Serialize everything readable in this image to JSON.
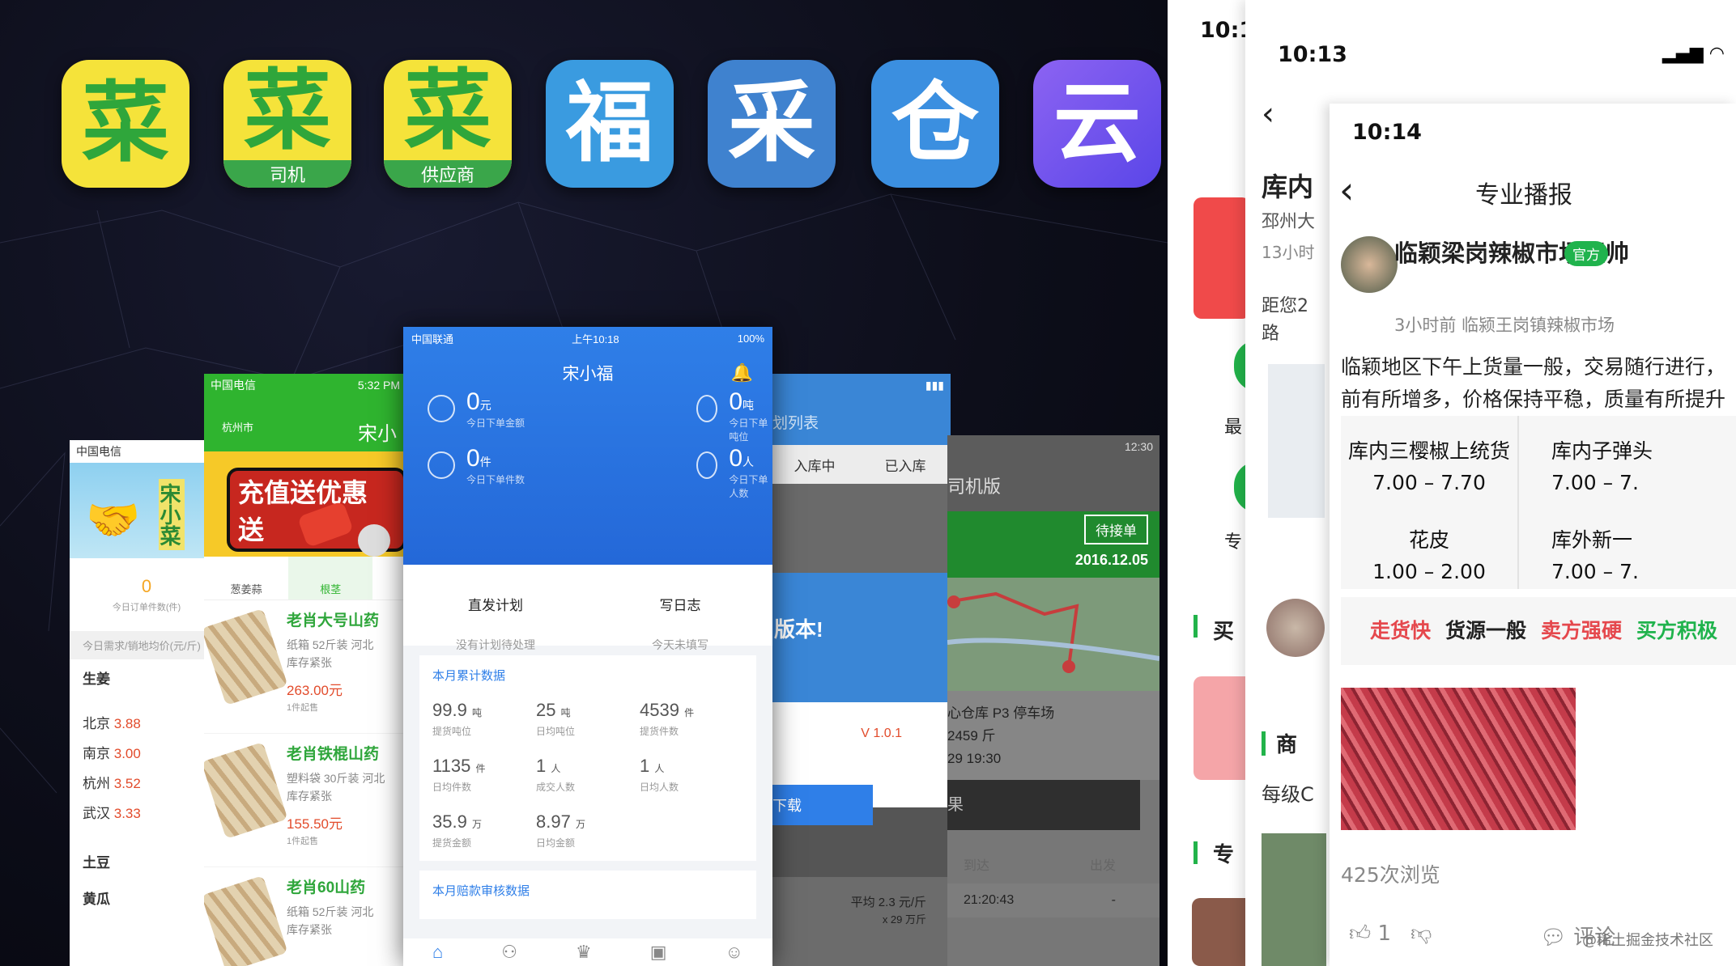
{
  "icons": [
    {
      "glyph": "菜",
      "band": "",
      "style": "yellow"
    },
    {
      "glyph": "菜",
      "band": "司机",
      "style": "yellow"
    },
    {
      "glyph": "菜",
      "band": "供应商",
      "style": "yellow"
    },
    {
      "glyph": "福",
      "band": "",
      "style": "blue1"
    },
    {
      "glyph": "采",
      "band": "",
      "style": "blue2"
    },
    {
      "glyph": "仓",
      "band": "",
      "style": "blue3"
    },
    {
      "glyph": "云",
      "band": "",
      "style": "purple"
    }
  ],
  "phone1": {
    "carrier": "中国电信",
    "logo_text": "宋小菜",
    "zero": "0",
    "zero_label": "今日订单件数(件)",
    "bar_text": "今日需求/销地均价(元/斤)",
    "category": "生姜",
    "prices": [
      {
        "city": "北京",
        "price": "3.88"
      },
      {
        "city": "南京",
        "price": "3.00"
      },
      {
        "city": "杭州",
        "price": "3.52"
      },
      {
        "city": "武汉",
        "price": "3.33"
      }
    ],
    "more": [
      "土豆",
      "黄瓜"
    ]
  },
  "phone2": {
    "carrier": "中国电信",
    "time": "5:32 PM",
    "location": "杭州市",
    "title": "宋小菜",
    "banner": "充值送优惠 送",
    "categories": [
      "葱姜蒜",
      "根茎"
    ],
    "items": [
      {
        "name": "老肖大号山药",
        "desc": "纸箱 52斤装 河北",
        "stock": "库存紧张",
        "price": "263.00元",
        "min": "1件起售"
      },
      {
        "name": "老肖铁棍山药",
        "desc": "塑料袋 30斤装 河北",
        "stock": "库存紧张",
        "price": "155.50元",
        "min": "1件起售"
      },
      {
        "name": "老肖60山药",
        "desc": "纸箱 52斤装 河北",
        "stock": "库存紧张",
        "price": "",
        "min": ""
      }
    ]
  },
  "phone3": {
    "carrier": "中国联通",
    "time": "上午10:18",
    "battery": "100%",
    "title": "宋小福",
    "stats": [
      {
        "value": "0",
        "unit": "元",
        "label": "今日下单金额"
      },
      {
        "value": "0",
        "unit": "吨",
        "label": "今日下单吨位"
      },
      {
        "value": "0",
        "unit": "件",
        "label": "今日下单件数"
      },
      {
        "value": "0",
        "unit": "人",
        "label": "今日下单人数"
      }
    ],
    "actions": [
      {
        "title": "直发计划",
        "sub": "没有计划待处理"
      },
      {
        "title": "写日志",
        "sub": "今天未填写"
      }
    ],
    "card_title": "本月累计数据",
    "grid": [
      {
        "v": "99.9",
        "u": "吨",
        "l": "提货吨位"
      },
      {
        "v": "25",
        "u": "吨",
        "l": "日均吨位"
      },
      {
        "v": "4539",
        "u": "件",
        "l": "提货件数"
      },
      {
        "v": "1135",
        "u": "件",
        "l": "日均件数"
      },
      {
        "v": "1",
        "u": "人",
        "l": "成交人数"
      },
      {
        "v": "1",
        "u": "人",
        "l": "日均人数"
      },
      {
        "v": "35.9",
        "u": "万",
        "l": "提货金额"
      },
      {
        "v": "8.97",
        "u": "万",
        "l": "日均金额"
      }
    ],
    "card2_title": "本月赔款审核数据"
  },
  "phone4": {
    "title": "划列表",
    "tabs": [
      "入库中",
      "已入库"
    ],
    "new_version": "版本!",
    "version": "V 1.0.1",
    "download": "下载",
    "avg": "平均 2.3 元/斤",
    "qty": "x 29 万斤"
  },
  "phone5": {
    "time": "12:30",
    "title": "司机版",
    "pending": "待接单",
    "date": "2016.12.05",
    "info": [
      "心仓库 P3 停车场",
      "2459 斤",
      "29 19:30"
    ],
    "btn": "果",
    "cols": [
      "到达",
      "出发"
    ],
    "row": [
      "21:20:43",
      "-"
    ]
  },
  "right": {
    "time_a": "10:1",
    "time_b": "10:13",
    "time_c": "10:14",
    "a_labels": [
      "最",
      "专",
      "买",
      "专"
    ],
    "b_title": "库内",
    "b_lines": [
      "邳州大",
      "13小时",
      "距您2",
      "路"
    ],
    "b_sections": [
      "商",
      "每级C"
    ],
    "c_title": "专业播报",
    "author": "临颖梁岗辣椒市场王帅",
    "official": "官方",
    "meta": "3小时前  临颍王岗镇辣椒市场",
    "body": "临颖地区下午上货量一般，交易随行进行，前有所增多，价格保持平稳，质量有所提升",
    "prices": [
      {
        "name": "库内三樱椒上统货",
        "range": "7.00 – 7.70"
      },
      {
        "name": "库内子弹头",
        "range": "7.00 – 7."
      },
      {
        "name": "花皮",
        "range": "1.00 – 2.00"
      },
      {
        "name": "库外新一",
        "range": "7.00 – 7."
      }
    ],
    "tags": [
      {
        "t": "走货快",
        "c": "#e5484d"
      },
      {
        "t": "货源一般",
        "c": "#222222"
      },
      {
        "t": "卖方强硬",
        "c": "#e5484d"
      },
      {
        "t": "买方积极",
        "c": "#20b34d"
      }
    ],
    "views": "425次浏览",
    "likes": "1",
    "comment": "评论",
    "watermark": "@稀土掘金技术社区"
  }
}
